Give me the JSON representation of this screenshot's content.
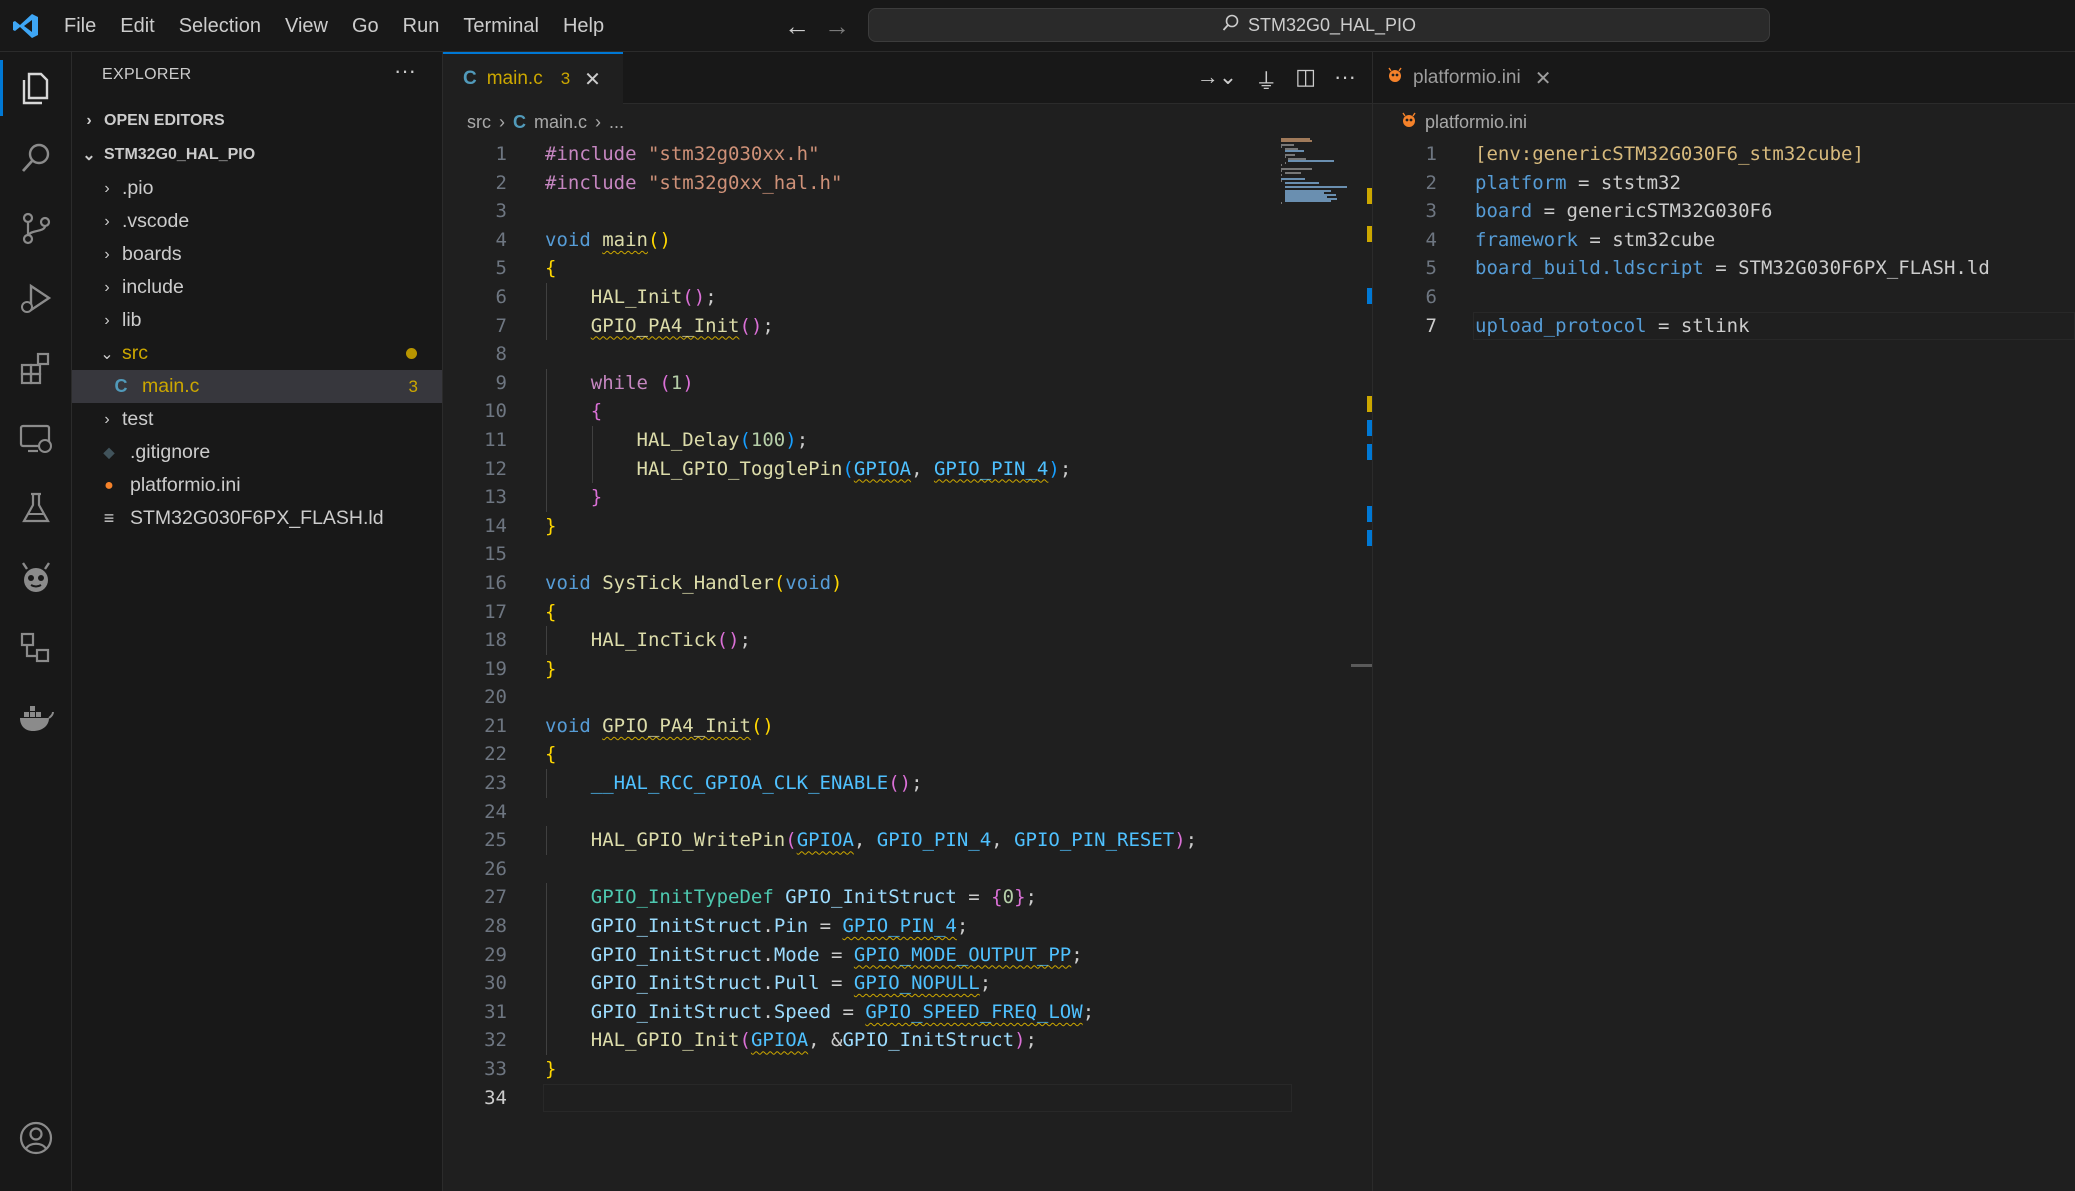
{
  "titlebar": {
    "menu": [
      "File",
      "Edit",
      "Selection",
      "View",
      "Go",
      "Run",
      "Terminal",
      "Help"
    ],
    "search_text": "STM32G0_HAL_PIO"
  },
  "activitybar": {
    "items": [
      "explorer-icon",
      "search-icon",
      "source-control-icon",
      "run-debug-icon",
      "extensions-icon",
      "remote-explorer-icon",
      "testing-icon",
      "platformio-icon",
      "json-outline-icon",
      "docker-icon"
    ],
    "account": "account-icon"
  },
  "sidebar": {
    "title": "EXPLORER",
    "more": "···",
    "open_editors": "OPEN EDITORS",
    "project": "STM32G0_HAL_PIO",
    "tree": [
      {
        "label": ".pio",
        "type": "folder"
      },
      {
        "label": ".vscode",
        "type": "folder"
      },
      {
        "label": "boards",
        "type": "folder"
      },
      {
        "label": "include",
        "type": "folder"
      },
      {
        "label": "lib",
        "type": "folder"
      },
      {
        "label": "src",
        "type": "folder-open"
      },
      {
        "label": "main.c",
        "type": "c-file",
        "badge": "3"
      },
      {
        "label": "test",
        "type": "folder"
      },
      {
        "label": ".gitignore",
        "type": "git-file"
      },
      {
        "label": "platformio.ini",
        "type": "pio-file"
      },
      {
        "label": "STM32G030F6PX_FLASH.ld",
        "type": "text-file"
      }
    ]
  },
  "editor1": {
    "tab_label": "main.c",
    "tab_badge": "3",
    "tab_icon": "C",
    "breadcrumb": [
      "src",
      "main.c",
      "..."
    ],
    "code": [
      "#include \"stm32g030xx.h\"",
      "#include \"stm32g0xx_hal.h\"",
      "",
      "void main()",
      "{",
      "    HAL_Init();",
      "    GPIO_PA4_Init();",
      "",
      "    while (1)",
      "    {",
      "        HAL_Delay(100);",
      "        HAL_GPIO_TogglePin(GPIOA, GPIO_PIN_4);",
      "    }",
      "}",
      "",
      "void SysTick_Handler(void)",
      "{",
      "    HAL_IncTick();",
      "}",
      "",
      "void GPIO_PA4_Init()",
      "{",
      "    __HAL_RCC_GPIOA_CLK_ENABLE();",
      "",
      "    HAL_GPIO_WritePin(GPIOA, GPIO_PIN_4, GPIO_PIN_RESET);",
      "",
      "    GPIO_InitTypeDef GPIO_InitStruct = {0};",
      "    GPIO_InitStruct.Pin = GPIO_PIN_4;",
      "    GPIO_InitStruct.Mode = GPIO_MODE_OUTPUT_PP;",
      "    GPIO_InitStruct.Pull = GPIO_NOPULL;",
      "    GPIO_InitStruct.Speed = GPIO_SPEED_FREQ_LOW;",
      "    HAL_GPIO_Init(GPIOA, &GPIO_InitStruct);",
      "}",
      ""
    ],
    "current_line": 34
  },
  "editor2": {
    "tab_label": "platformio.ini",
    "breadcrumb": "platformio.ini",
    "code": [
      "[env:genericSTM32G030F6_stm32cube]",
      "platform = ststm32",
      "board = genericSTM32G030F6",
      "framework = stm32cube",
      "board_build.ldscript = STM32G030F6PX_FLASH.ld",
      "",
      "upload_protocol = stlink"
    ],
    "current_line": 7
  },
  "colors": {
    "accent": "#0078d4",
    "warning": "#cca700",
    "background": "#1f1f1f",
    "sidebar": "#181818"
  }
}
